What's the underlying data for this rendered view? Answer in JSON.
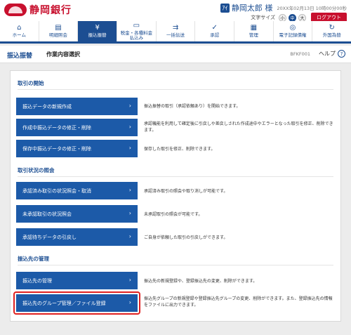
{
  "header": {
    "bank_name": "静岡銀行",
    "user_icon": "ｱｲ",
    "user_name": "静岡太郎 様",
    "datetime": "20XX年02月13日 10時00分00秒",
    "font_size_label": "文字サイズ",
    "font_sizes": [
      "小",
      "中",
      "大"
    ],
    "logout_label": "ログアウト"
  },
  "nav": {
    "items": [
      {
        "icon": "home-icon",
        "glyph": "⌂",
        "label": "ホーム"
      },
      {
        "icon": "document-icon",
        "glyph": "▤",
        "label": "明細照会"
      },
      {
        "icon": "yen-circle-icon",
        "glyph": "¥",
        "label": "振込振替"
      },
      {
        "icon": "tax-payment-icon",
        "glyph": "▭",
        "label": "税金・各種料金\n払込み"
      },
      {
        "icon": "batch-transfer-icon",
        "glyph": "⇉",
        "label": "一括伝送"
      },
      {
        "icon": "approval-icon",
        "glyph": "✓",
        "label": "承認"
      },
      {
        "icon": "management-icon",
        "glyph": "▦",
        "label": "管理"
      },
      {
        "icon": "electronic-bond-icon",
        "glyph": "◎",
        "label": "電子記録債権"
      },
      {
        "icon": "foreign-exchange-icon",
        "glyph": "↻",
        "label": "外国為替"
      }
    ]
  },
  "title_bar": {
    "title": "振込振替",
    "subtitle": "作業内容選択",
    "screen_id": "BFKF001",
    "help_label": "ヘルプ",
    "help_glyph": "?"
  },
  "sections": [
    {
      "title": "取引の開始",
      "items": [
        {
          "label": "振込データの新規作成",
          "desc": "振込振替の取引（承認依頼あり）を開始できます。"
        },
        {
          "label": "作成中振込データの修正・削除",
          "desc": "承認機能を利用して確定後に引戻しや差戻しされた作成途中やエラーとなった取引を修正、削除できます。"
        },
        {
          "label": "保存中振込データの修正・削除",
          "desc": "保存した取引を修正、削除できます。"
        }
      ]
    },
    {
      "title": "取引状況の照会",
      "items": [
        {
          "label": "承認済み取引の状況照会・取消",
          "desc": "承認済み取引の照会や取り消しが可能です。"
        },
        {
          "label": "未承認取引の状況照会",
          "desc": "未承認取引の照会が可能です。"
        },
        {
          "label": "承認待ちデータの引戻し",
          "desc": "ご自身が依頼した取引の引戻しができます。"
        }
      ]
    },
    {
      "title": "振込先の管理",
      "items": [
        {
          "label": "振込先の管理",
          "desc": "振込先の新規登録や、登録振込先の変更、削除ができます。"
        },
        {
          "label": "振込先のグループ管理／ファイル登録",
          "desc": "振込先グループの新規登録や登録振込先グループの変更、削除ができます。また、登録振込先の情報をファイルに出力できます。"
        }
      ]
    }
  ],
  "chevron": "›",
  "colors": {
    "brand_red": "#c8102e",
    "navy": "#1c4e92",
    "button_blue": "#1c5aa8",
    "highlight_red": "#e02020"
  }
}
